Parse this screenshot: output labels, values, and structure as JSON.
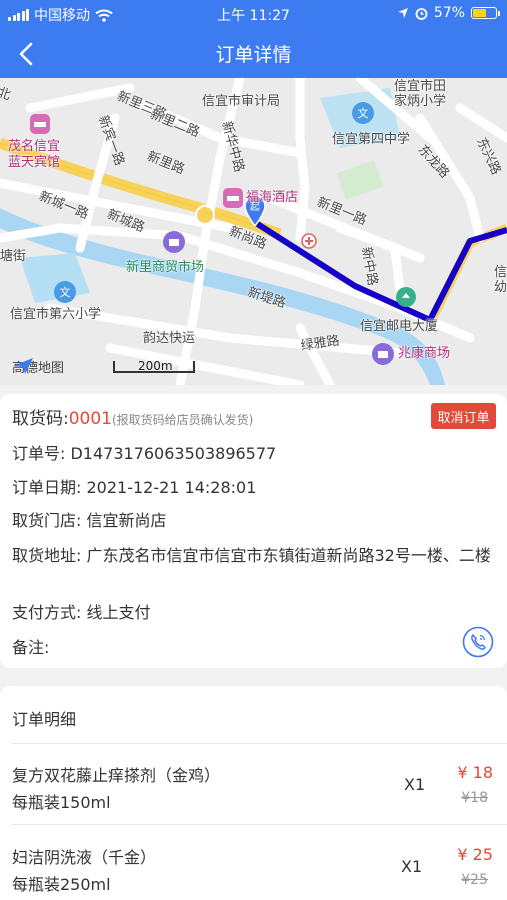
{
  "status_bar": {
    "carrier": "中国移动",
    "time": "上午 11:27",
    "battery": "57%",
    "battery_level": 0.57,
    "icons": [
      "signal-icon",
      "wifi-icon",
      "location-arrow-icon",
      "alarm-icon",
      "battery-icon"
    ]
  },
  "nav": {
    "title": "订单详情",
    "back_icon": "chevron-left-icon"
  },
  "map": {
    "logo": "高德地图",
    "scale": "200m",
    "start_marker": "起",
    "labels": {
      "sanlu": "新里三路",
      "shenji": "信宜市审计局",
      "tianjia_1": "信宜市田",
      "tianjia_2": "家炳小学",
      "erlu": "新里二路",
      "xinbinyilu": "新宾一路",
      "xinhualu": "新华中路",
      "disizhong": "信宜第四中学",
      "donglong": "东龙路",
      "dongxing": "东兴路",
      "binguan_1": "茂名信宜",
      "binguan_2": "蓝天宾馆",
      "xinlilu": "新里路",
      "fuhai": "福海酒店",
      "xinchenyilu": "新城一路",
      "xinchenglu": "新城路",
      "xinshang": "新尚路",
      "xinliyilu": "新里一路",
      "xinzhong": "新中路",
      "tangjie": "塘街",
      "shangmao": "新里商贸市场",
      "xinti": "新堤路",
      "xinyi_edge": "信",
      "you_edge": "幼",
      "liuxiao": "信宜市第六小学",
      "youdian": "信宜邮电大厦",
      "yunda": "韵达快运",
      "lvchi": "绿雅路",
      "zhaokang": "兆康商场",
      "bei": "北"
    }
  },
  "order": {
    "pickup_code_label": "取货码:",
    "pickup_code": "0001",
    "pickup_tip": "(报取货码给店员确认发货)",
    "cancel_button": "取消订单",
    "order_no": "订单号:  D1473176063503896577",
    "order_date": "订单日期:  2021-12-21 14:28:01",
    "store": "取货门店:  信宜新尚店",
    "address": "取货地址:  广东茂名市信宜市信宜市东镇街道新尚路32号一楼、二楼",
    "payment": "支付方式:  线上支付",
    "remark": "备注:",
    "phone_icon": "phone-icon"
  },
  "details": {
    "title": "订单明细",
    "items": [
      {
        "name": "复方双花藤止痒搽剂（金鸡）",
        "spec": "每瓶装150ml",
        "qty": "X1",
        "price": "¥ 18",
        "original_price": "¥18"
      },
      {
        "name": "妇洁阴洗液（千金）",
        "spec": "每瓶装250ml",
        "qty": "X1",
        "price": "¥ 25",
        "original_price": "¥25"
      }
    ]
  },
  "colors": {
    "primary": "#3d7bf0",
    "accent_red": "#e14a37",
    "route": "#1400c8"
  }
}
